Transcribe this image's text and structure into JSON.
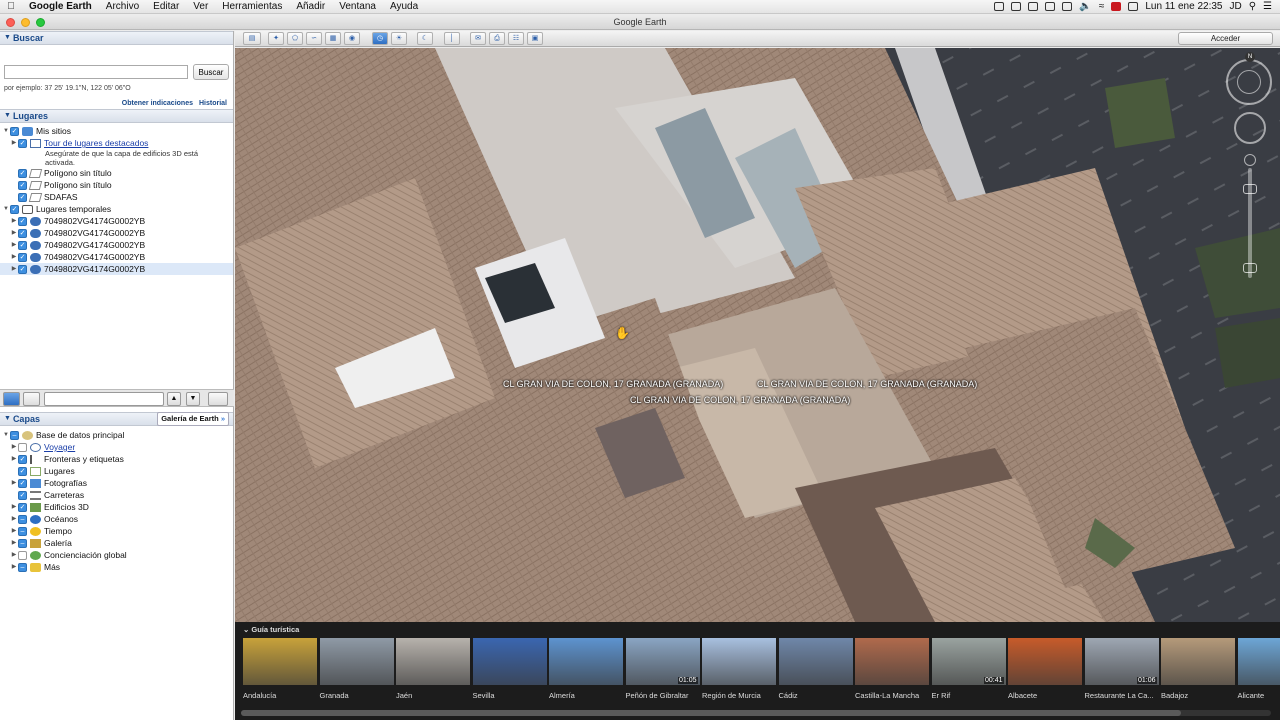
{
  "menubar": {
    "app": "Google Earth",
    "items": [
      "Archivo",
      "Editar",
      "Ver",
      "Herramientas",
      "Añadir",
      "Ventana",
      "Ayuda"
    ],
    "clock": "Lun 11 ene  22:35",
    "user": "JD"
  },
  "window": {
    "title": "Google Earth"
  },
  "search": {
    "header": "Buscar",
    "placeholder": "",
    "button": "Buscar",
    "hint": "por ejemplo: 37 25' 19.1\"N, 122 05' 06\"O",
    "directions": "Obtener indicaciones",
    "history": "Historial"
  },
  "places": {
    "header": "Lugares",
    "my_places": "Mis sitios",
    "tour": "Tour de lugares destacados",
    "tour_note_1": "Asegúrate de que la capa de edificios 3D está",
    "tour_note_2": "activada.",
    "poly1": "Polígono sin título",
    "poly2": "Polígono sin título",
    "sdafas": "SDAFAS",
    "temp": "Lugares temporales",
    "temp_items": [
      "7049802VG4174G0002YB",
      "7049802VG4174G0002YB",
      "7049802VG4174G0002YB",
      "7049802VG4174G0002YB",
      "7049802VG4174G0002YB"
    ]
  },
  "layers": {
    "header": "Capas",
    "gallery_button": "Galería de Earth",
    "root": "Base de datos principal",
    "items": [
      "Voyager",
      "Fronteras y etiquetas",
      "Lugares",
      "Fotografías",
      "Carreteras",
      "Edificios 3D",
      "Océanos",
      "Tiempo",
      "Galería",
      "Concienciación global",
      "Más"
    ]
  },
  "toolbar": {
    "signin": "Acceder"
  },
  "map": {
    "compass_north": "N",
    "labels": [
      "CL GRAN VIA DE COLON, 17  GRANADA (GRANADA)",
      "CL GRAN VIA DE COLON, 17  GRANADA (GRANADA)",
      "CL GRAN VIA DE COLON, 17  GRANADA (GRANADA)"
    ]
  },
  "tour_guide": {
    "header": "Guía turística",
    "items": [
      {
        "name": "Andalucía",
        "duration": "",
        "color": "#c8a23a"
      },
      {
        "name": "Granada",
        "duration": "",
        "color": "#8f9aa6"
      },
      {
        "name": "Jaén",
        "duration": "",
        "color": "#b7b2ac"
      },
      {
        "name": "Sevilla",
        "duration": "",
        "color": "#3a66b0"
      },
      {
        "name": "Almería",
        "duration": "",
        "color": "#5d93cf"
      },
      {
        "name": "Peñón de Gibraltar",
        "duration": "01:05",
        "color": "#8aa5c3"
      },
      {
        "name": "Región de Murcia",
        "duration": "",
        "color": "#a8c0df"
      },
      {
        "name": "Cádiz",
        "duration": "",
        "color": "#6f87a9"
      },
      {
        "name": "Castilla-La Mancha",
        "duration": "",
        "color": "#b06a4c"
      },
      {
        "name": "Er Rif",
        "duration": "00:41",
        "color": "#9aa3a0"
      },
      {
        "name": "Albacete",
        "duration": "",
        "color": "#c75b2a"
      },
      {
        "name": "Restaurante La Ca...",
        "duration": "01:06",
        "color": "#9ea7b3"
      },
      {
        "name": "Badajoz",
        "duration": "",
        "color": "#b59a7a"
      },
      {
        "name": "Alicante",
        "duration": "",
        "color": "#6da6d6"
      }
    ]
  }
}
